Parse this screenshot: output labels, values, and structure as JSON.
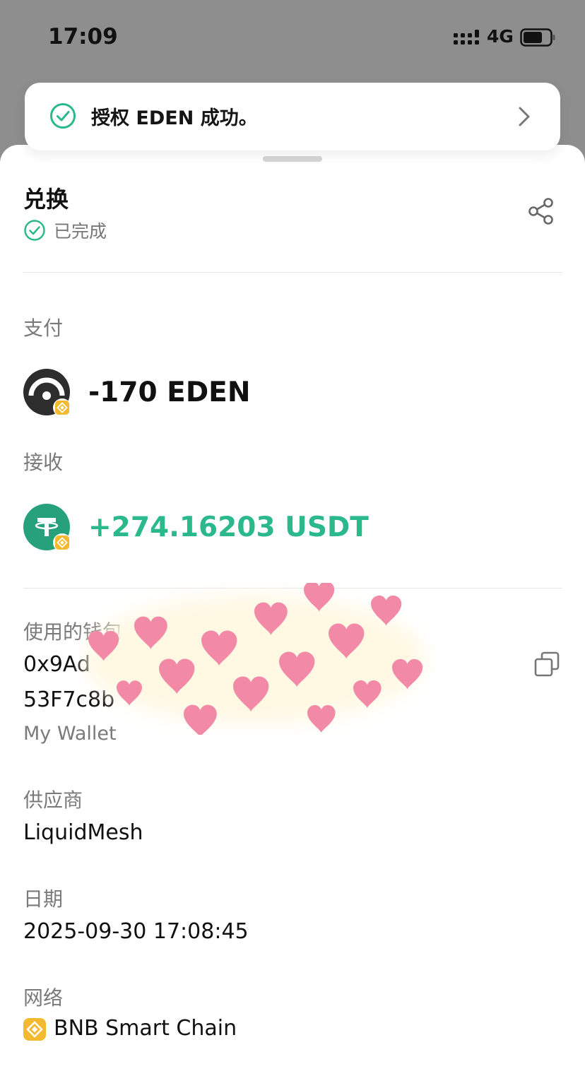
{
  "status_bar": {
    "time": "17:09",
    "network": "4G",
    "icons": [
      "signal-bars-icon",
      "battery-icon"
    ]
  },
  "toast": {
    "text": "授权 EDEN 成功。",
    "icon": "check-circle-icon",
    "trailing_icon": "chevron-right-icon"
  },
  "sheet": {
    "title": "兑换",
    "status": "已完成",
    "share_icon": "share-icon"
  },
  "pay": {
    "label": "支付",
    "amount": "-170 EDEN",
    "token_icon": "eden-token-icon"
  },
  "receive": {
    "label": "接收",
    "amount": "+274.16203 USDT",
    "token_icon": "usdt-token-icon"
  },
  "wallet": {
    "label": "使用的钱包",
    "address_line1": "0x9Ad",
    "address_line2": "53F7c8b",
    "address_tail": "5",
    "name": "My Wallet",
    "copy_icon": "copy-icon"
  },
  "provider": {
    "label": "供应商",
    "value": "LiquidMesh"
  },
  "date": {
    "label": "日期",
    "value": "2025-09-30 17:08:45"
  },
  "network": {
    "label": "网络",
    "value": "BNB Smart Chain",
    "icon": "bnb-chain-icon"
  },
  "colors": {
    "success_green": "#2bb98b",
    "usdt_teal": "#26a17b",
    "bnb_yellow": "#f3ba2f",
    "overlay_gray": "#8e8e8e"
  }
}
